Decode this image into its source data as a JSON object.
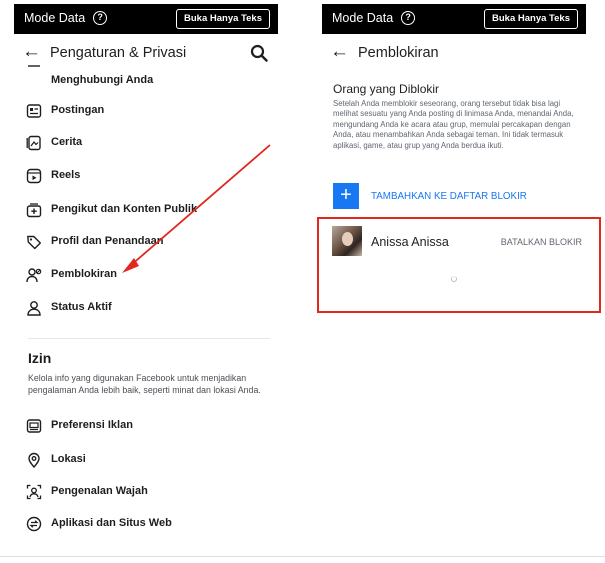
{
  "left": {
    "topbar": {
      "mode_label": "Mode Data",
      "help_glyph": "?",
      "text_only_button": "Buka Hanya Teks"
    },
    "nav": {
      "title": "Pengaturan & Privasi",
      "back_icon": "back-arrow-icon",
      "search_icon": "search-icon"
    },
    "menu_items": [
      {
        "label": "Menghubungi Anda",
        "icon": "contact-icon"
      },
      {
        "label": "Postingan",
        "icon": "post-icon"
      },
      {
        "label": "Cerita",
        "icon": "story-icon"
      },
      {
        "label": "Reels",
        "icon": "reels-icon"
      },
      {
        "label": "Pengikut dan Konten Publik",
        "icon": "followers-icon"
      },
      {
        "label": "Profil dan Penandaan",
        "icon": "tag-icon"
      },
      {
        "label": "Pemblokiran",
        "icon": "block-user-icon"
      },
      {
        "label": "Status Aktif",
        "icon": "active-status-icon"
      }
    ],
    "izin": {
      "title": "Izin",
      "description": "Kelola info yang digunakan Facebook untuk menjadikan pengalaman Anda lebih baik, seperti minat dan lokasi Anda."
    },
    "izin_items": [
      {
        "label": "Preferensi Iklan",
        "icon": "ad-preferences-icon"
      },
      {
        "label": "Lokasi",
        "icon": "location-pin-icon"
      },
      {
        "label": "Pengenalan Wajah",
        "icon": "face-recognition-icon"
      },
      {
        "label": "Aplikasi dan Situs Web",
        "icon": "apps-websites-icon"
      }
    ]
  },
  "right": {
    "topbar": {
      "mode_label": "Mode Data",
      "help_glyph": "?",
      "text_only_button": "Buka Hanya Teks"
    },
    "nav": {
      "title": "Pemblokiran",
      "back_icon": "back-arrow-icon"
    },
    "blocked": {
      "title": "Orang yang Diblokir",
      "description": "Setelah Anda memblokir seseorang, orang tersebut tidak bisa lagi melihat sesuatu yang Anda posting di linimasa Anda, menandai Anda, mengundang Anda ke acara atau grup, memulai percakapan dengan Anda, atau menambahkan Anda sebagai teman. Ini tidak termasuk aplikasi, game, atau grup yang Anda berdua ikuti.",
      "add_glyph": "+",
      "add_label": "TAMBAHKAN KE DAFTAR BLOKIR",
      "users": [
        {
          "name": "Anissa Anissa",
          "action": "BATALKAN BLOKIR"
        }
      ]
    }
  },
  "colors": {
    "accent": "#1877f2",
    "annotation_red": "#e0281f",
    "topbar": "#000000"
  }
}
